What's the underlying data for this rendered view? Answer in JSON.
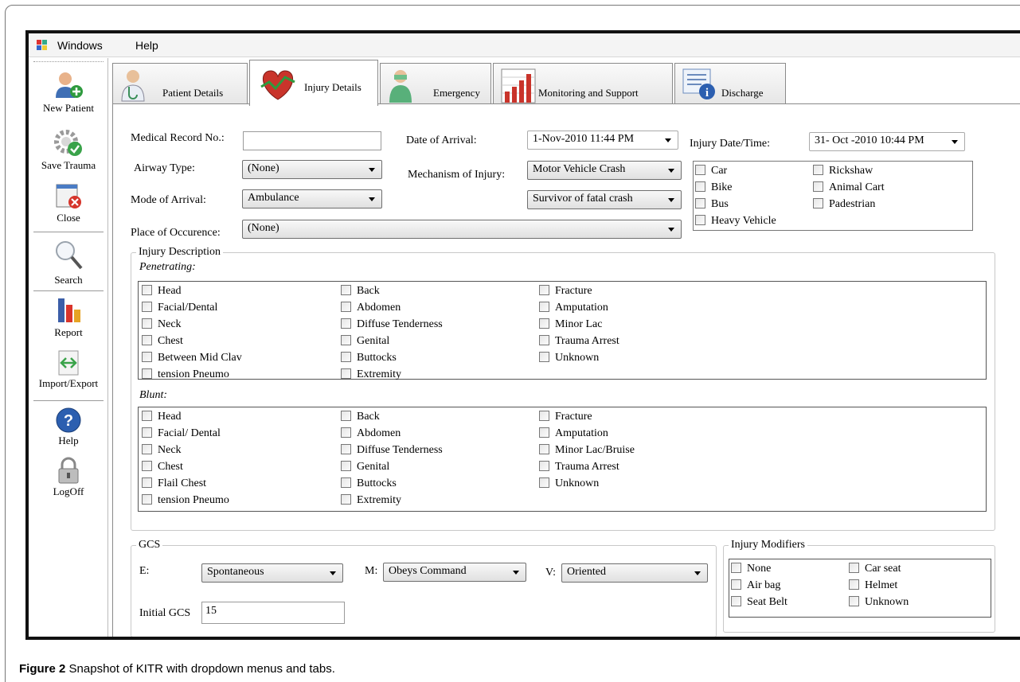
{
  "caption": {
    "fig": "Figure 2",
    "text": "Snapshot of KITR with dropdown menus and tabs."
  },
  "menu": {
    "windows": "Windows",
    "help": "Help"
  },
  "sidebar": {
    "new_patient": "New Patient",
    "save_trauma": "Save Trauma",
    "close": "Close",
    "search": "Search",
    "report": "Report",
    "import_export": "Import/Export",
    "help": "Help",
    "logoff": "LogOff"
  },
  "tabs": [
    "Patient Details",
    "Injury Details",
    "Emergency",
    "Monitoring and Support",
    "Discharge"
  ],
  "form": {
    "mrn_label": "Medical Record No.:",
    "mrn_value": "",
    "date_arrival_label": "Date of Arrival:",
    "date_arrival_value": "1-Nov-2010 11:44 PM",
    "injury_dt_label": "Injury Date/Time:",
    "injury_dt_value": "31- Oct -2010 10:44 PM",
    "airway_label": "Airway Type:",
    "airway_value": "(None)",
    "mechanism_label": "Mechanism of Injury:",
    "mechanism_value": "Motor Vehicle Crash",
    "mechanism_value2": "Survivor of fatal crash",
    "mode_label": "Mode of Arrival:",
    "mode_value": "Ambulance",
    "place_label": "Place of Occurence:",
    "place_value": "(None)"
  },
  "vehicles": {
    "col1": [
      "Car",
      "Bike",
      "Bus",
      "Heavy Vehicle"
    ],
    "col2": [
      "Rickshaw",
      "Animal Cart",
      "Padestrian"
    ]
  },
  "injury_description": {
    "title": "Injury Description",
    "penetrating_label": "Penetrating:",
    "penetrating": {
      "col1": [
        "Head",
        "Facial/Dental",
        "Neck",
        "Chest",
        "Between Mid Clav",
        "tension Pneumo"
      ],
      "col2": [
        "Back",
        "Abdomen",
        "Diffuse Tenderness",
        "Genital",
        "Buttocks",
        "Extremity"
      ],
      "col3": [
        "Fracture",
        "Amputation",
        "Minor Lac",
        "Trauma Arrest",
        "Unknown"
      ]
    },
    "blunt_label": "Blunt:",
    "blunt": {
      "col1": [
        "Head",
        "Facial/ Dental",
        "Neck",
        "Chest",
        "Flail Chest",
        "tension Pneumo"
      ],
      "col2": [
        "Back",
        "Abdomen",
        "Diffuse Tenderness",
        "Genital",
        "Buttocks",
        "Extremity"
      ],
      "col3": [
        "Fracture",
        "Amputation",
        "Minor Lac/Bruise",
        "Trauma Arrest",
        "Unknown"
      ]
    }
  },
  "gcs": {
    "title": "GCS",
    "e_label": "E:",
    "e_value": "Spontaneous",
    "m_label": "M:",
    "m_value": "Obeys Command",
    "v_label": "V:",
    "v_value": "Oriented",
    "initial_label": "Initial GCS",
    "initial_value": "15"
  },
  "modifiers": {
    "title": "Injury Modifiers",
    "col1": [
      "None",
      "Air bag",
      "Seat Belt"
    ],
    "col2": [
      "Car seat",
      "Helmet",
      "Unknown"
    ]
  }
}
